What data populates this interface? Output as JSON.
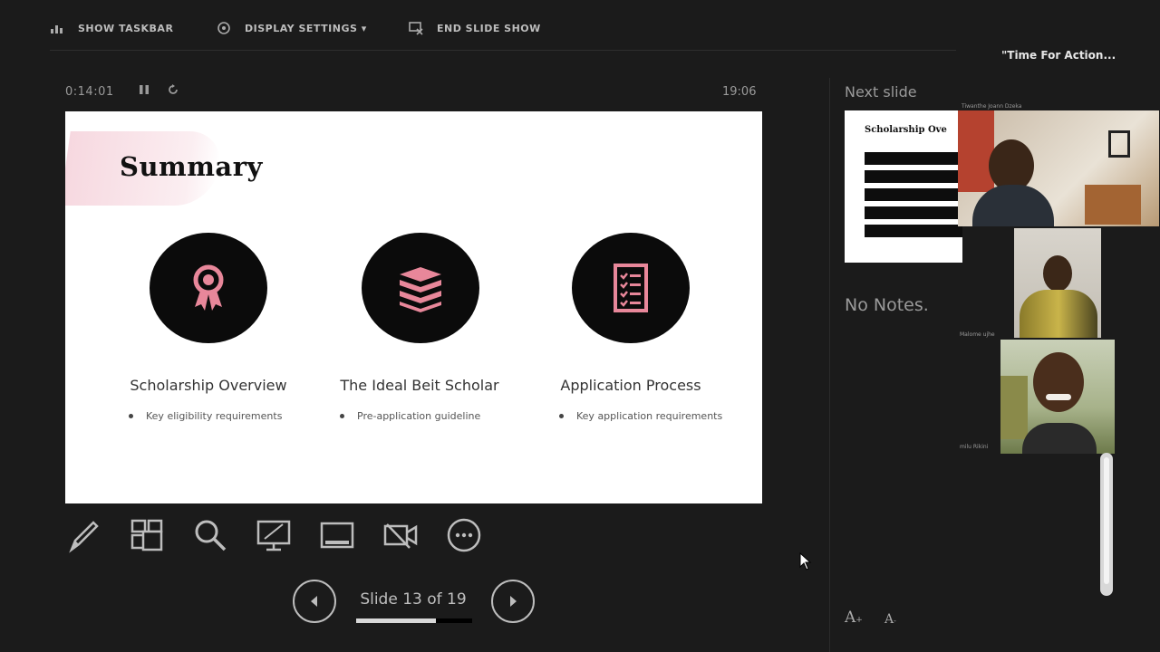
{
  "toolbar": {
    "show_taskbar": "SHOW TASKBAR",
    "display_settings": "DISPLAY SETTINGS ▾",
    "end_slide_show": "END SLIDE SHOW"
  },
  "meeting": {
    "title": "\"Time For Action..."
  },
  "timer": {
    "elapsed": "0:14:01",
    "clock": "19:06"
  },
  "slide": {
    "title": "Summary",
    "columns": [
      {
        "icon": "award-ribbon-icon",
        "title": "Scholarship Overview",
        "bullet": "Key eligibility requirements"
      },
      {
        "icon": "stacked-books-icon",
        "title": "The Ideal Beit Scholar",
        "bullet": "Pre-application guideline"
      },
      {
        "icon": "checklist-icon",
        "title": "Application Process",
        "bullet": "Key application requirements"
      }
    ],
    "accent_color": "#e8879a"
  },
  "bottom_tools": [
    {
      "name": "pen-icon"
    },
    {
      "name": "see-all-slides-icon"
    },
    {
      "name": "zoom-icon"
    },
    {
      "name": "pointer-screen-icon"
    },
    {
      "name": "black-screen-icon"
    },
    {
      "name": "camera-toggle-icon"
    },
    {
      "name": "more-options-icon"
    }
  ],
  "navigation": {
    "counter": "Slide 13 of 19",
    "current": 13,
    "total": 19
  },
  "right_panel": {
    "next_slide_label": "Next slide",
    "next_slide_title": "Scholarship Ove",
    "notes": "No Notes."
  },
  "video_tiles": [
    {
      "label": "Tiwanthe Joann Dzeka"
    },
    {
      "label": "Malome  ujhe"
    },
    {
      "label": "milu Rikini"
    }
  ]
}
